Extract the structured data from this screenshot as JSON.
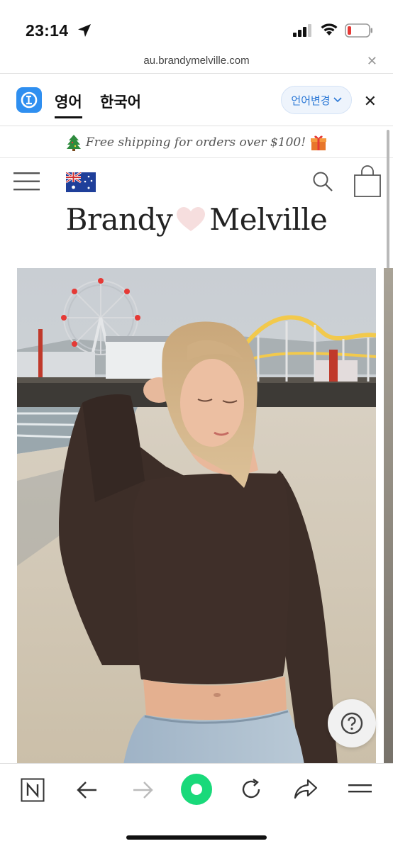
{
  "status": {
    "time": "23:14"
  },
  "browser": {
    "url": "au.brandymelville.com"
  },
  "translate": {
    "tabs": [
      {
        "label": "영어",
        "active": true
      },
      {
        "label": "한국어",
        "active": false
      }
    ],
    "change_language": "언어변경"
  },
  "announcement": {
    "text": "Free shipping for orders over $100!"
  },
  "brand": {
    "left": "Brandy",
    "right": "Melville"
  },
  "colors": {
    "translate_accent": "#2f8ff0",
    "play_button": "#19d97a",
    "heart": "#f6dede"
  },
  "icons": [
    "location-arrow-icon",
    "signal-icon",
    "wifi-icon",
    "battery-icon",
    "close-icon",
    "translate-logo-icon",
    "chevron-down-icon",
    "christmas-tree-icon",
    "gift-icon",
    "menu-icon",
    "australia-flag-icon",
    "search-icon",
    "shopping-bag-icon",
    "heart-icon",
    "help-icon",
    "naver-icon",
    "back-icon",
    "forward-icon",
    "green-dot-icon",
    "reload-icon",
    "share-icon",
    "more-menu-icon"
  ]
}
